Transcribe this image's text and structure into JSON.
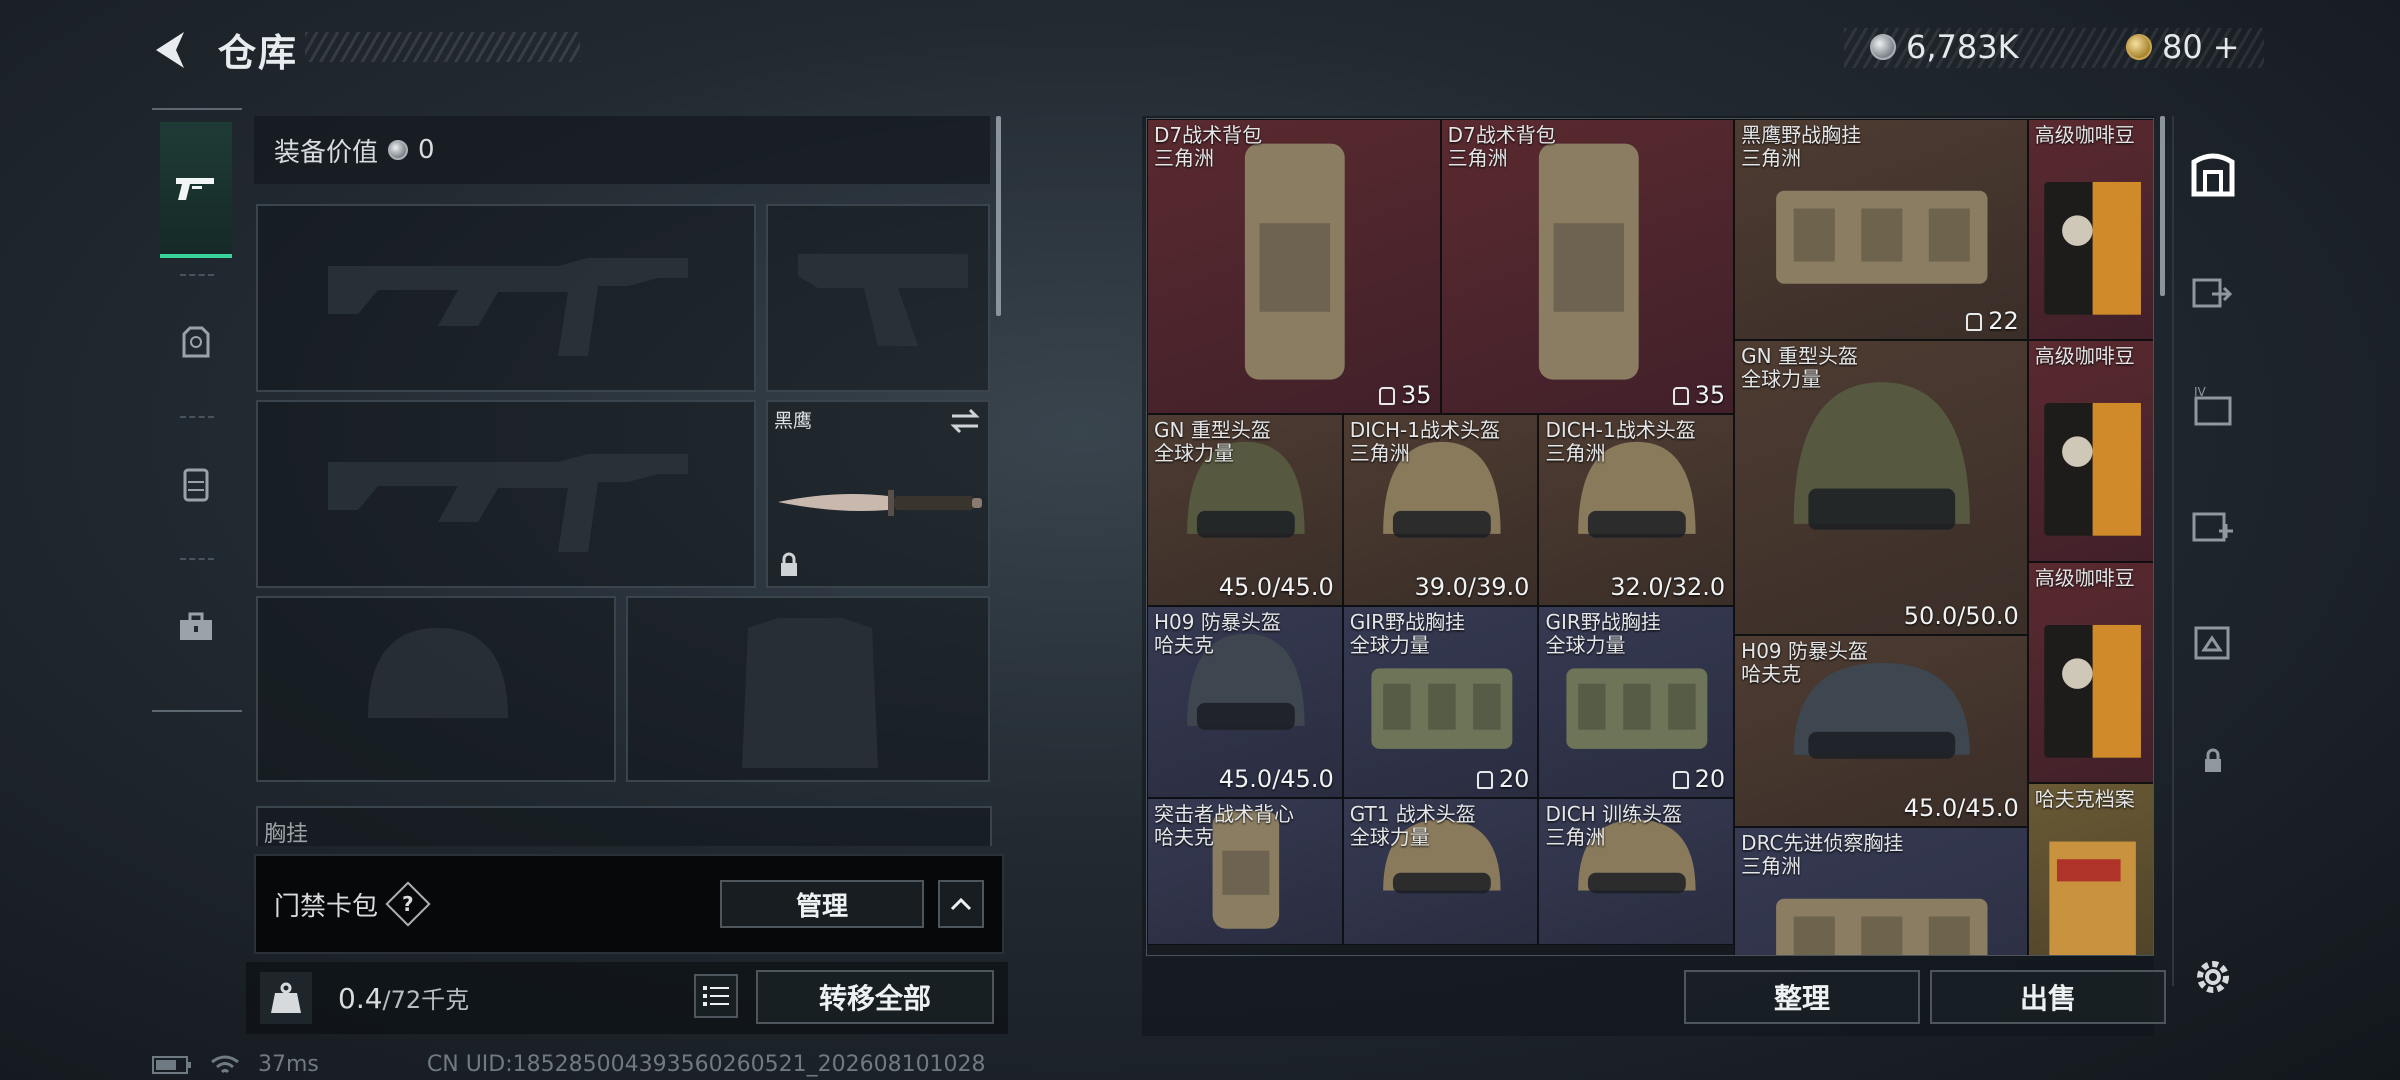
{
  "header": {
    "title": "仓库",
    "back_icon": "back-arrow-icon"
  },
  "currency": {
    "silver_amount": "6,783K",
    "gold_amount": "80",
    "gold_plus": "+"
  },
  "left_nav": {
    "items": [
      {
        "icon": "pistol-icon",
        "active": true
      },
      {
        "icon": "helmet-armor-icon",
        "active": false
      },
      {
        "icon": "backpack-rig-icon",
        "active": false
      },
      {
        "icon": "toolbox-icon",
        "active": false
      }
    ]
  },
  "equipment": {
    "value_label": "装备价值",
    "value_amount": "0",
    "melee_label": "黑鹰",
    "next_section_label": "胸挂",
    "help_badge": "?"
  },
  "access_card": {
    "label": "门禁卡包",
    "help": "?",
    "manage_button": "管理"
  },
  "weight": {
    "current": "0.4",
    "max": "/72千克",
    "icon_label": "KG",
    "transfer_all_button": "转移全部"
  },
  "inventory": {
    "items": [
      {
        "name": "D7战术背包",
        "sub": "三角洲",
        "qty": "35",
        "qty_icon": "capacity-icon",
        "rarity": "red"
      },
      {
        "name": "D7战术背包",
        "sub": "三角洲",
        "qty": "35",
        "qty_icon": "capacity-icon",
        "rarity": "red"
      },
      {
        "name": "黑鹰野战胸挂",
        "sub": "三角洲",
        "qty": "22",
        "qty_icon": "vest-icon",
        "rarity": "brown"
      },
      {
        "name": "高级咖啡豆",
        "sub": "",
        "qty": "",
        "rarity": "red"
      },
      {
        "name": "GN 重型头盔",
        "sub": "全球力量",
        "qty": "50.0/50.0",
        "rarity": "brown"
      },
      {
        "name": "高级咖啡豆",
        "sub": "",
        "qty": "",
        "rarity": "red"
      },
      {
        "name": "GN 重型头盔",
        "sub": "全球力量",
        "qty": "45.0/45.0",
        "rarity": "brown"
      },
      {
        "name": "DICH-1战术头盔",
        "sub": "三角洲",
        "qty": "39.0/39.0",
        "rarity": "brown"
      },
      {
        "name": "DICH-1战术头盔",
        "sub": "三角洲",
        "qty": "32.0/32.0",
        "rarity": "brown"
      },
      {
        "name": "H09 防暴头盔",
        "sub": "哈夫克",
        "qty": "45.0/45.0",
        "rarity": "navy"
      },
      {
        "name": "高级咖啡豆",
        "sub": "",
        "qty": "",
        "rarity": "red"
      },
      {
        "name": "H09 防暴头盔",
        "sub": "哈夫克",
        "qty": "45.0/45.0",
        "rarity": "brown"
      },
      {
        "name": "GIR野战胸挂",
        "sub": "全球力量",
        "qty": "20",
        "qty_icon": "vest-icon",
        "rarity": "navy"
      },
      {
        "name": "GIR野战胸挂",
        "sub": "全球力量",
        "qty": "20",
        "qty_icon": "vest-icon",
        "rarity": "navy"
      },
      {
        "name": "DRC先进侦察胸挂",
        "sub": "三角洲",
        "qty": "",
        "rarity": "navy"
      },
      {
        "name": "哈夫克档案",
        "sub": "",
        "qty": "",
        "rarity": "gold"
      },
      {
        "name": "突击者战术背心",
        "sub": "哈夫克",
        "qty": "",
        "rarity": "navy"
      },
      {
        "name": "GT1 战术头盔",
        "sub": "全球力量",
        "qty": "",
        "rarity": "navy"
      },
      {
        "name": "DICH 训练头盔",
        "sub": "三角洲",
        "qty": "",
        "rarity": "navy"
      }
    ],
    "sort_button": "整理",
    "sell_button": "出售"
  },
  "right_tools": [
    "storage-icon",
    "stash-transfer-icon",
    "level-storage-icon",
    "medical-icon",
    "expand-icon",
    "lock-icon",
    "settings-icon"
  ],
  "status": {
    "ping": "37ms",
    "uid": "CN UID:1852850043935602605​21_202608101028"
  }
}
